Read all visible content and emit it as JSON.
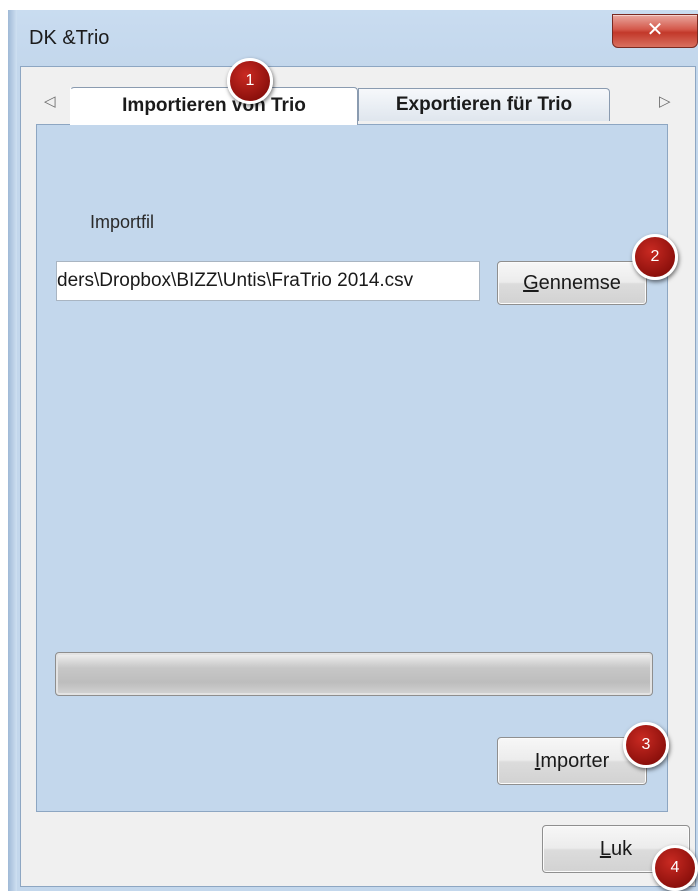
{
  "window": {
    "title": "DK &Trio",
    "close_glyph": "✕"
  },
  "tabs": {
    "scroll_left_glyph": "◁",
    "scroll_right_glyph": "▷",
    "items": [
      {
        "label": "Importieren von Trio",
        "active": true
      },
      {
        "label": "Exportieren für Trio",
        "active": false
      }
    ]
  },
  "import": {
    "file_label": "Importfil",
    "file_path_value": "ders\\Dropbox\\BIZZ\\Untis\\FraTrio 2014.csv",
    "browse_label_mnemonic": "G",
    "browse_label_rest": "ennemse",
    "import_label_mnemonic": "I",
    "import_label_rest": "mporter",
    "progress_fraction": 0.0
  },
  "footer": {
    "close_label_mnemonic": "L",
    "close_label_rest": "uk"
  },
  "badges": [
    "1",
    "2",
    "3",
    "4"
  ],
  "colors": {
    "panel_background": "#c3d7ec",
    "badge_red": "#b01a14",
    "close_button_red": "#c2382a"
  }
}
